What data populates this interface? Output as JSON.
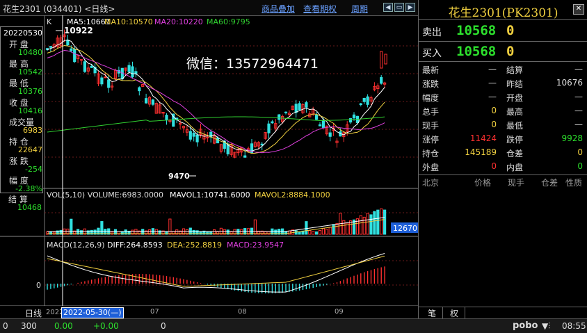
{
  "topbar": {
    "title": "花生2301 (034401) <日线>",
    "menu_overlay": "商品叠加",
    "menu_period": "查看期权",
    "menu_cycle": "周期"
  },
  "info": {
    "date": "20220530",
    "open_label": "开  盘",
    "open": "10480",
    "high_label": "最  高",
    "high": "10542",
    "low_label": "最  低",
    "low": "10376",
    "close_label": "收  盘",
    "close": "10416",
    "vol_label": "成交量",
    "vol": "6983",
    "oi_label": "持  仓",
    "oi": "22647",
    "chg_label": "涨  跌",
    "chg": "-254",
    "pct_label": "幅  度",
    "pct": "-2.38%",
    "settle_label": "结  算",
    "settle": "10468"
  },
  "main": {
    "k_label": "K",
    "ma5": "MA5:10661",
    "ma10": "MA10:10570",
    "ma20": "MA20:10220",
    "ma60": "MA60:9795",
    "high_mark": "10922",
    "low_mark": "9470",
    "watermark": "微信：13572964471"
  },
  "volume": {
    "label": "VOL(5,10) VOLUME:6983.0000",
    "mavol1": "MAVOL1:10741.6000",
    "mavol2": "MAVOL2:8884.1000",
    "axis_value": "12670"
  },
  "macd": {
    "label": "MACD(12,26,9)",
    "diff": "DIFF:264.8593",
    "dea": "DEA:252.8819",
    "macd": "MACD:23.9547",
    "zero": "0"
  },
  "xaxis": {
    "period": "日线",
    "year": "2022",
    "cursor_date": "2022-05-30(—)",
    "m07": "07",
    "m08": "08",
    "m09": "09"
  },
  "right": {
    "title": "花生2301(PK2301)",
    "sell_label": "卖出",
    "sell_price": "10568",
    "sell_vol": "0",
    "buy_label": "买入",
    "buy_price": "10568",
    "buy_vol": "0",
    "rows": [
      {
        "l1": "最新",
        "v1": "—",
        "l2": "结算",
        "v2": "—"
      },
      {
        "l1": "涨跌",
        "v1": "—",
        "l2": "昨结",
        "v2": "10676"
      },
      {
        "l1": "幅度",
        "v1": "—",
        "l2": "开盘",
        "v2": "—"
      },
      {
        "l1": "总手",
        "v1": "0",
        "l2": "最高",
        "v2": "—"
      },
      {
        "l1": "现手",
        "v1": "0",
        "l2": "最低",
        "v2": "—"
      },
      {
        "l1": "涨停",
        "v1": "11424",
        "l2": "跌停",
        "v2": "9928"
      },
      {
        "l1": "持仓",
        "v1": "145189",
        "l2": "仓差",
        "v2": "0"
      },
      {
        "l1": "外盘",
        "v1": "0",
        "l2": "内盘",
        "v2": "0"
      }
    ],
    "ticks_headers": [
      "北京",
      "价格",
      "现手",
      "仓差",
      "性质"
    ],
    "tab1": "笔",
    "tab2": "权"
  },
  "statusbar": {
    "s0": "0",
    "s1": "300",
    "s2": "0.00",
    "s3": "+0.00",
    "s4": "0",
    "brand": "pobo",
    "time": "08:55"
  },
  "colors": {
    "ma5": "#ffffff",
    "ma10": "#f0d040",
    "ma20": "#e040e0",
    "ma60": "#30d030",
    "up": "#ff3030",
    "down": "#30e0e0",
    "green": "#2de02d",
    "red": "#ff3030",
    "yellow": "#f0d040"
  }
}
